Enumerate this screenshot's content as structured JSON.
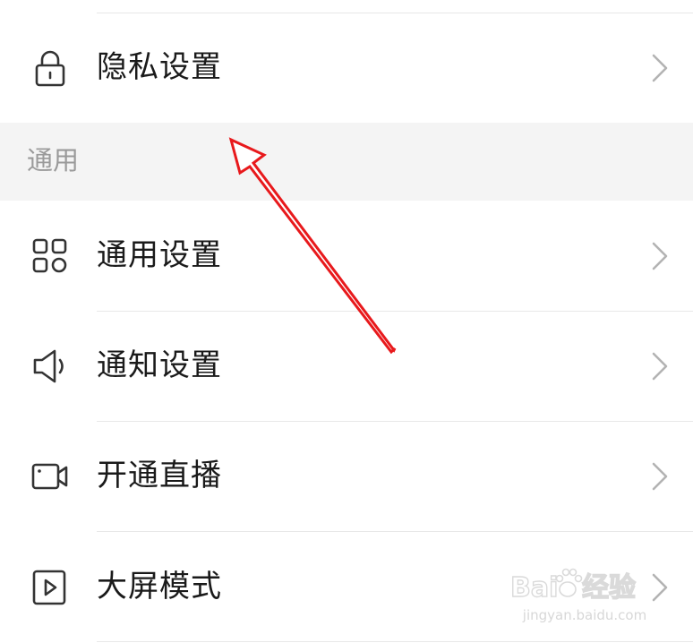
{
  "rows": [
    {
      "label": "隐私设置",
      "icon": "lock-icon"
    },
    {
      "label": "通用设置",
      "icon": "grid-icon"
    },
    {
      "label": "通知设置",
      "icon": "speaker-icon"
    },
    {
      "label": "开通直播",
      "icon": "camera-icon"
    },
    {
      "label": "大屏模式",
      "icon": "play-screen-icon"
    }
  ],
  "section": {
    "title": "通用"
  },
  "annotation": {
    "color": "#e8191c",
    "icon": "red-arrow-annotation"
  },
  "watermark": {
    "brand": "Baidu经验",
    "url": "jingyan.baidu.com"
  }
}
